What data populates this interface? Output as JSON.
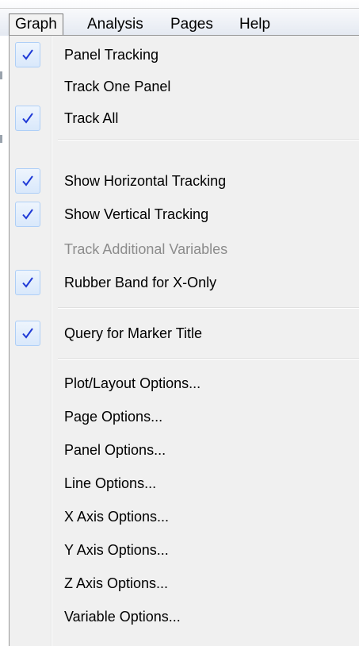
{
  "menubar": {
    "items": [
      {
        "label": "Graph"
      },
      {
        "label": "Analysis"
      },
      {
        "label": "Pages"
      },
      {
        "label": "Help"
      }
    ]
  },
  "graph_menu": {
    "items": [
      {
        "label": "Panel Tracking",
        "checked": true,
        "enabled": true
      },
      {
        "label": "Track One Panel",
        "checked": false,
        "enabled": true
      },
      {
        "label": "Track All",
        "checked": true,
        "enabled": true
      },
      {
        "label": "Show Horizontal Tracking",
        "checked": true,
        "enabled": true
      },
      {
        "label": "Show Vertical Tracking",
        "checked": true,
        "enabled": true
      },
      {
        "label": "Track Additional Variables",
        "checked": false,
        "enabled": false
      },
      {
        "label": "Rubber Band for X-Only",
        "checked": true,
        "enabled": true
      },
      {
        "label": "Query for Marker Title",
        "checked": true,
        "enabled": true
      },
      {
        "label": "Plot/Layout Options...",
        "checked": false,
        "enabled": true
      },
      {
        "label": "Page Options...",
        "checked": false,
        "enabled": true
      },
      {
        "label": "Panel Options...",
        "checked": false,
        "enabled": true
      },
      {
        "label": "Line Options...",
        "checked": false,
        "enabled": true
      },
      {
        "label": "X Axis Options...",
        "checked": false,
        "enabled": true
      },
      {
        "label": "Y Axis Options...",
        "checked": false,
        "enabled": true
      },
      {
        "label": "Z Axis Options...",
        "checked": false,
        "enabled": true
      },
      {
        "label": "Variable Options...",
        "checked": false,
        "enabled": true
      }
    ]
  },
  "colors": {
    "check_mark": "#1f3ad6",
    "disabled_text": "#8c8c8c",
    "menu_background": "#f0f0f0"
  },
  "icons": {
    "check": "check-icon"
  }
}
